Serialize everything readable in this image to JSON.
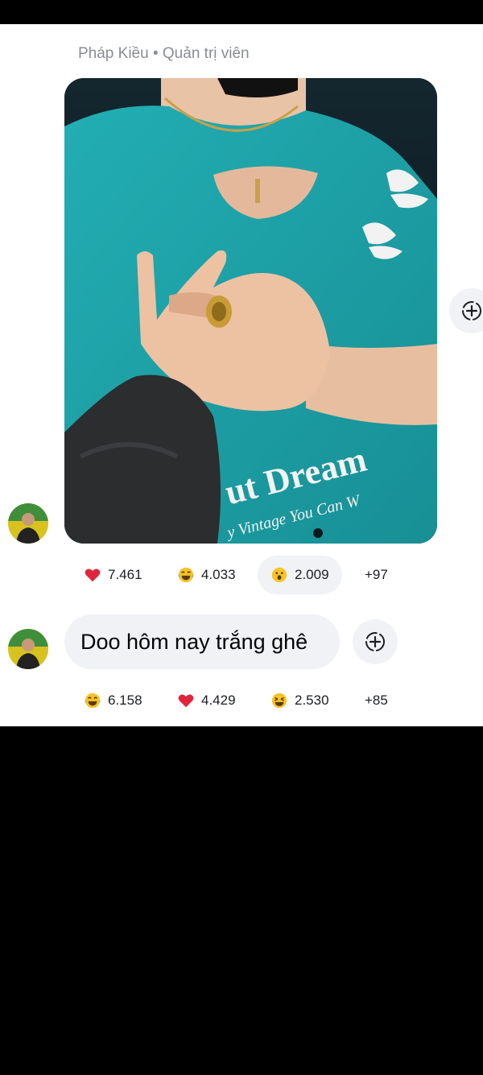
{
  "message1": {
    "sender_name": "Pháp Kiều",
    "separator": "•",
    "sender_role": "Quản trị viên",
    "photo_text": {
      "line1": "ut Dream",
      "line2": "y Vintage You Can W"
    },
    "reactions": [
      {
        "icon": "heart-icon",
        "count": "7.461",
        "selected": false
      },
      {
        "icon": "laughing-tears-icon",
        "count": "4.033",
        "selected": false
      },
      {
        "icon": "wow-face-icon",
        "count": "2.009",
        "selected": true
      }
    ],
    "more": "+97"
  },
  "message2": {
    "text": "Doo hôm nay trắng ghê",
    "reactions": [
      {
        "icon": "laughing-tears-icon",
        "count": "6.158",
        "selected": false
      },
      {
        "icon": "heart-icon",
        "count": "4.429",
        "selected": false
      },
      {
        "icon": "grinning-squint-icon",
        "count": "2.530",
        "selected": false
      }
    ],
    "more": "+85"
  },
  "colors": {
    "panel": "#ffffff",
    "bubble": "#f0f2f5",
    "secondary_text": "#8a8d91",
    "shirt": "#1fa3a8",
    "heart": "#e0243b",
    "emoji_yellow": "#f7c325"
  }
}
